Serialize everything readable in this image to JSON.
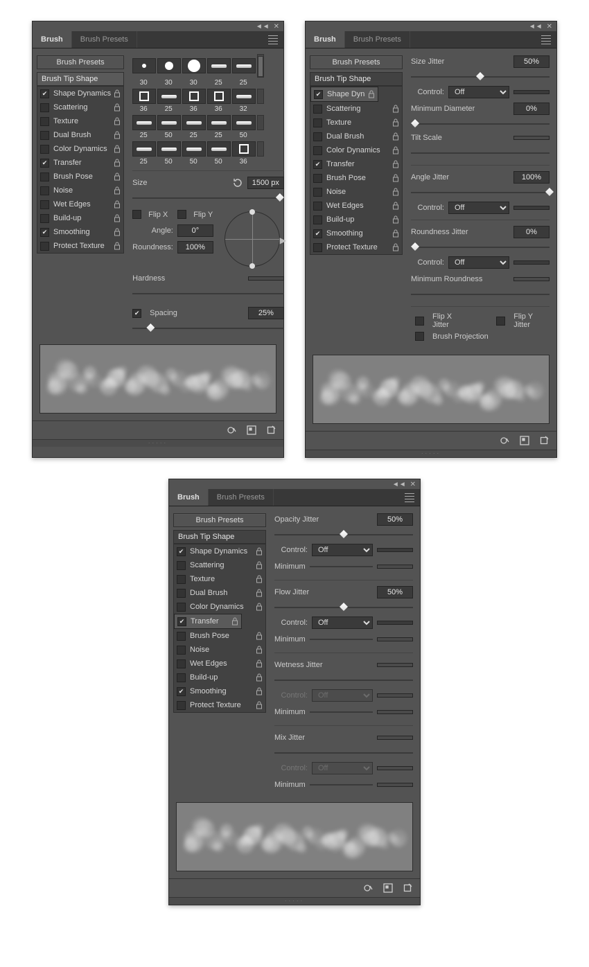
{
  "tabs": {
    "brush": "Brush",
    "presets": "Brush Presets"
  },
  "presets_button": "Brush Presets",
  "tip_shape": "Brush Tip Shape",
  "items": [
    {
      "label": "Shape Dynamics",
      "checked": true
    },
    {
      "label": "Scattering",
      "checked": false
    },
    {
      "label": "Texture",
      "checked": false
    },
    {
      "label": "Dual Brush",
      "checked": false
    },
    {
      "label": "Color Dynamics",
      "checked": false
    },
    {
      "label": "Transfer",
      "checked": true
    },
    {
      "label": "Brush Pose",
      "checked": false
    },
    {
      "label": "Noise",
      "checked": false
    },
    {
      "label": "Wet Edges",
      "checked": false
    },
    {
      "label": "Build-up",
      "checked": false
    },
    {
      "label": "Smoothing",
      "checked": true
    },
    {
      "label": "Protect Texture",
      "checked": false
    }
  ],
  "panel1": {
    "swatch_sizes": [
      "30",
      "30",
      "30",
      "25",
      "25",
      "36",
      "25",
      "36",
      "36",
      "32",
      "25",
      "50",
      "25",
      "25",
      "50",
      "25",
      "50",
      "50",
      "50",
      "36"
    ],
    "size_label": "Size",
    "size_value": "1500 px",
    "flipx": "Flip X",
    "flipy": "Flip Y",
    "angle_label": "Angle:",
    "angle_value": "0°",
    "round_label": "Roundness:",
    "round_value": "100%",
    "hard_label": "Hardness",
    "spacing_label": "Spacing",
    "spacing_value": "25%",
    "spacing_pct": 12
  },
  "panel2": {
    "size_jitter": "Size Jitter",
    "size_jitter_v": "50%",
    "size_jitter_pct": 50,
    "control": "Control:",
    "control_v": "Off",
    "min_dia": "Minimum Diameter",
    "min_dia_v": "0%",
    "tilt": "Tilt Scale",
    "angle_jitter": "Angle Jitter",
    "angle_jitter_v": "100%",
    "angle_jitter_pct": 100,
    "round_jitter": "Roundness Jitter",
    "round_jitter_v": "0%",
    "min_round": "Minimum Roundness",
    "flipxj": "Flip X Jitter",
    "flipyj": "Flip Y Jitter",
    "brushproj": "Brush Projection"
  },
  "panel3": {
    "opj": "Opacity Jitter",
    "opj_v": "50%",
    "opj_pct": 50,
    "control": "Control:",
    "control_v": "Off",
    "min": "Minimum",
    "flj": "Flow Jitter",
    "flj_v": "50%",
    "flj_pct": 50,
    "wet": "Wetness Jitter",
    "mix": "Mix Jitter"
  }
}
